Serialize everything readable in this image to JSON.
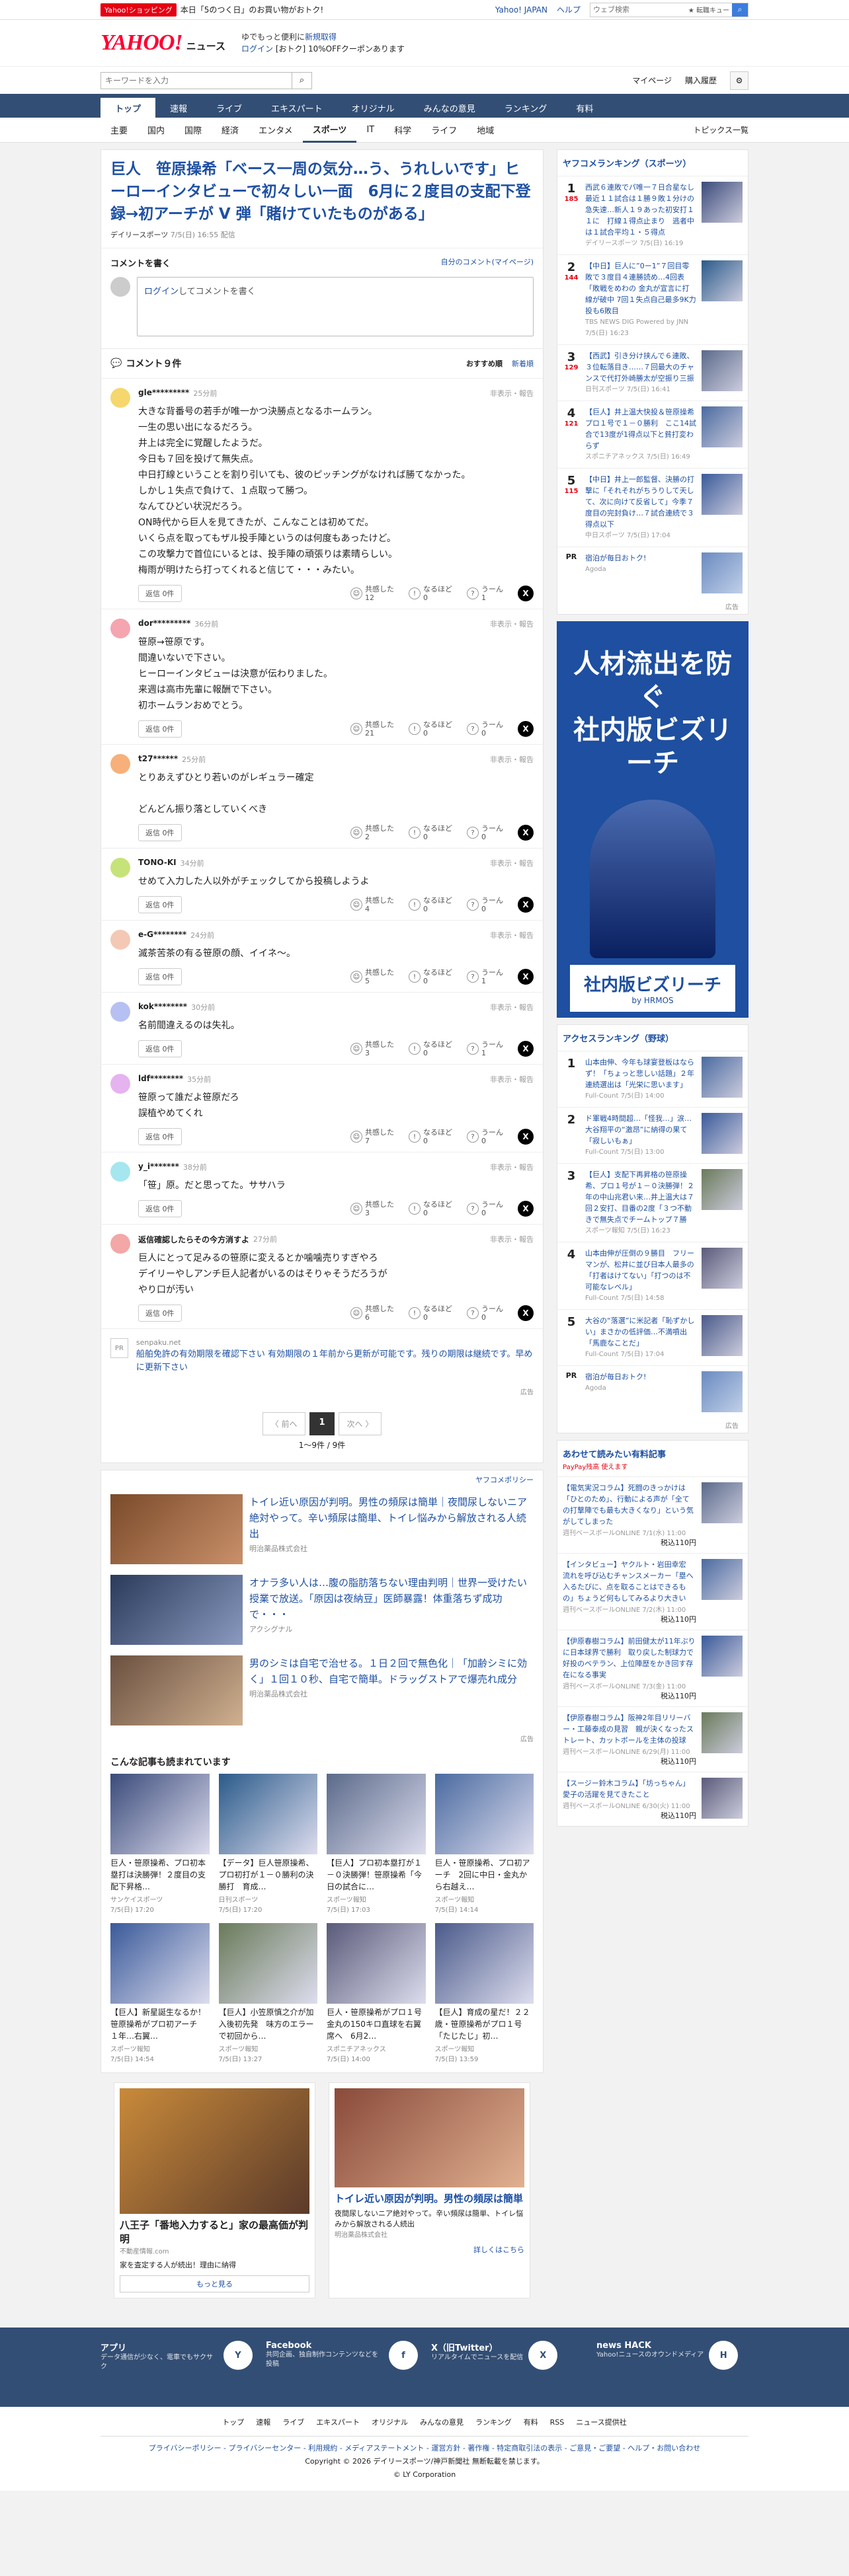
{
  "topbar": {
    "badge": "Yahoo!ショッピング",
    "promo": "本日「5のつく日」のお買い物がおトク!",
    "links": [
      "Yahoo! JAPAN",
      "ヘルプ"
    ],
    "search_placeholder": "ウェブ検索",
    "search_btn": "Q",
    "fav": "★ 転職キュー"
  },
  "header": {
    "logo": "YAHOO!",
    "logo_sub": "JAPAN",
    "news": "ニュース",
    "promo1": "ゆでもっと便利に",
    "promo1b": "新規取得",
    "login": "ログイン",
    "promo2": "[おトク] 10%OFFクーポンあります"
  },
  "search": {
    "placeholder": "キーワードを入力",
    "links": [
      "マイページ",
      "購入履歴"
    ]
  },
  "nav1": [
    "トップ",
    "速報",
    "ライブ",
    "エキスパート",
    "オリジナル",
    "みんなの意見",
    "ランキング",
    "有料"
  ],
  "nav2": [
    "主要",
    "国内",
    "国際",
    "経済",
    "エンタメ",
    "スポーツ",
    "IT",
    "科学",
    "ライフ",
    "地域"
  ],
  "nav2_right": "トピックス一覧",
  "article": {
    "title": "巨人　笹原操希「ベース一周の気分…う、うれしいです」ヒーローインタビューで初々しい一面　6月に２度目の支配下登録→初アーチが V 弾「賭けていたものがある」",
    "source": "デイリースポーツ",
    "date": "7/5(日) 16:55 配信"
  },
  "comment_form": {
    "heading": "コメントを書く",
    "mine": "自分のコメント(マイページ)",
    "login": "ログイン",
    "placeholder": "してコメントを書く"
  },
  "comments_header": {
    "title": "コメント９件",
    "sort1": "おすすめ順",
    "sort2": "新着順"
  },
  "labels": {
    "reply": "返信 0件 ",
    "hide": "非表示・報告",
    "r1": "共感した",
    "r2": "なるほど",
    "r3": "うーん"
  },
  "comments": [
    {
      "name": "gle*********",
      "time": "25分前",
      "text": "大きな背番号の若手が唯一かつ決勝点となるホームラン。\n一生の思い出になるだろう。\n井上は完全に覚醒したようだ。\n今日も７回を投げて無失点。\n中日打線ということを割り引いても、彼のピッチングがなければ勝てなかった。\nしかし１失点で負けて、１点取って勝つ。\nなんてひどい状況だろう。\nON時代から巨人を見てきたが、こんなことは初めてだ。\nいくら点を取ってもザル投手陣というのは何度もあったけど。\nこの攻撃力で首位にいるとは、投手陣の頑張りは素晴らしい。\n梅雨が明けたら打ってくれると信じて・・・みたい。",
      "c1": "12",
      "c2": "0",
      "c3": "1",
      "color": "#f5d76e"
    },
    {
      "name": "dor*********",
      "time": "36分前",
      "text": "笹原→笹原です。\n間違いないで下さい。\nヒーローインタビューは決意が伝わりました。\n来週は高市先輩に報酬で下さい。\n初ホームランおめでとう。",
      "c1": "21",
      "c2": "0",
      "c3": "0",
      "color": "#f5a5b0"
    },
    {
      "name": "t27******",
      "time": "25分前",
      "text": "とりあえずひとり若いのがレギュラー確定\n\nどんどん振り落としていくべき",
      "c1": "2",
      "c2": "0",
      "c3": "0",
      "color": "#f7b07a"
    },
    {
      "name": "TONO-KI",
      "time": "34分前",
      "text": "せめて入力した人以外がチェックしてから投稿しようよ",
      "c1": "4",
      "c2": "0",
      "c3": "0",
      "color": "#c6e37a"
    },
    {
      "name": "e-G********",
      "time": "24分前",
      "text": "滅茶苦茶の有る笹原の顔、イイネ〜。",
      "c1": "5",
      "c2": "0",
      "c3": "1",
      "color": "#f3c9b5"
    },
    {
      "name": "kok********",
      "time": "30分前",
      "text": "名前間違えるのは失礼。",
      "c1": "3",
      "c2": "0",
      "c3": "1",
      "color": "#b7c0f2"
    },
    {
      "name": "ldf********",
      "time": "35分前",
      "text": "笹原って誰だよ笹原だろ\n誤植やめてくれ",
      "c1": "7",
      "c2": "0",
      "c3": "0",
      "color": "#e5b3ef"
    },
    {
      "name": "y_i*******",
      "time": "38分前",
      "text": "「笹」原。だと思ってた。ササハラ",
      "c1": "3",
      "c2": "0",
      "c3": "0",
      "color": "#a6e6ef"
    },
    {
      "name": "返信確認したらその今方消すよ",
      "time": "27分前",
      "text": "巨人にとって足みるの笹原に変えるとか噛噛売りすぎやろ\nデイリーやしアンチ巨人記者がいるのはそりゃそうだろうが\nやり口が汚い",
      "c1": "6",
      "c2": "0",
      "c3": "0",
      "color": "#f3a7a7"
    }
  ],
  "pr_row": {
    "badge": "PR",
    "src": "senpaku.net",
    "text": "船舶免許の有効期限を確認下さい 有効期限の１年前から更新が可能です。残りの期限は継続です。早めに更新下さい"
  },
  "pager": {
    "prev": "〈 前へ",
    "page": "1",
    "next": "次へ 〉",
    "info": "1〜9件 / 9件"
  },
  "yahoo_policy": "ヤフコメポリシー",
  "ad_label": "広告",
  "ads": [
    {
      "title": "トイレ近い原因が判明。男性の頻尿は簡単｜夜間尿しないニア絶対やって。辛い頻尿は簡単、トイレ悩みから解放される人続出",
      "sponsor": "明治薬品株式会社"
    },
    {
      "title": "オナラ多い人は…腹の脂肪落ちない理由判明｜世界一受けたい授業で放送。「原因は夜納豆」医師暴露！体重落ちず成功で・・・",
      "sponsor": "アクシグナル"
    },
    {
      "title": "男のシミは自宅で治せる。１日２回で無色化｜「加齢シミに効く」１回１０秒、自宅で簡単。ドラッグストアで爆売れ成分",
      "sponsor": "明治薬品株式会社"
    }
  ],
  "also_read": {
    "title": "こんな記事も読まれています",
    "items": [
      {
        "t": "巨人・笹原操希、プロ初本塁打は決勝弾！２度目の支配下昇格…",
        "s": "サンケイスポーツ",
        "d": "7/5(日) 17:20"
      },
      {
        "t": "【データ】巨人笹原操希、プロ初打が１－０勝利の決勝打　育成…",
        "s": "日刊スポーツ",
        "d": "7/5(日) 17:20"
      },
      {
        "t": "【巨人】プロ初本塁打が１－０決勝弾！笹原操希「今日の試合に…",
        "s": "スポーツ報知",
        "d": "7/5(日) 17:03"
      },
      {
        "t": "巨人・笹原操希、プロ初アーチ　2回に中日・金丸から右越え…",
        "s": "スポーツ報知",
        "d": "7/5(日) 14:14"
      },
      {
        "t": "【巨人】新星誕生なるか！笹原操希がプロ初アーチ　１年…右翼…",
        "s": "スポーツ報知",
        "d": "7/5(日) 14:54"
      },
      {
        "t": "【巨人】小笠原慎之介が加入後初先発　味方のエラーで初回から…",
        "s": "スポーツ報知",
        "d": "7/5(日) 13:27"
      },
      {
        "t": "巨人・笹原操希がプロ１号　金丸の150キロ直球を右翼席へ　6月2…",
        "s": "スポニチアネックス",
        "d": "7/5(日) 14:00"
      },
      {
        "t": "【巨人】育成の星だ！２２歳・笹原操希がプロ１号「たじたじ」初…",
        "s": "スポーツ報知",
        "d": "7/5(日) 13:59"
      }
    ]
  },
  "bottom_ads": [
    {
      "t": "八王子「番地入力すると」家の最高価が判明",
      "s": "不動産情報.com",
      "d": "家を査定する人が続出！理由に納得",
      "btn": "もっと見る"
    },
    {
      "t": "トイレ近い原因が判明。男性の頻尿は簡単",
      "s": "明治薬品株式会社",
      "d": "夜間尿しないニア絶対やって。辛い頻尿は簡単、トイレ悩みから解放される人続出",
      "btn": "詳しくはこちら"
    }
  ],
  "sidebar": {
    "rank_title": "ヤフコメランキング（スポーツ）",
    "ranks": [
      {
        "n": "1",
        "c": "185",
        "t": "西武６連敗でパ唯一７日合星なし　最近１１試合は１勝９敗１分けの急失速…新人１９あった初安打１１に　打線１得点止まり　逃者中は１試合平均１・５得点",
        "s": "デイリースポーツ 7/5(日) 16:19"
      },
      {
        "n": "2",
        "c": "144",
        "t": "【中日】巨人に”0ー1”７回目零敗で３度目４連勝読め…4回表「敗戦をめわの 金丸が宣言に打線が破中 7回１失点自己最多9K力投も6敗目",
        "s": "TBS NEWS DIG Powered by JNN 7/5(日) 16:23"
      },
      {
        "n": "3",
        "c": "129",
        "t": "【西武】引き分け挟んで６連敗、３位転落目き……７回最大のチャンスで代打外崎勝太が空振り三振",
        "s": "日刊スポーツ 7/5(日) 16:41"
      },
      {
        "n": "4",
        "c": "121",
        "t": "【巨人】井上温大快投＆笹原操希プロ１号で１－０勝利　ここ14試合で13度が1得点以下と貧打変わらず",
        "s": "スポニチアネックス 7/5(日) 16:49"
      },
      {
        "n": "5",
        "c": "115",
        "t": "【中日】井上一郎監督、決勝の打撃に「それそれがちうりして天して、次に向けて反省して」今季７度目の完封負け…７試合連続で３得点以下",
        "s": "中日スポーツ 7/5(日) 17:04"
      }
    ],
    "pr": {
      "t": "宿泊が毎日おトク!",
      "s": "Agoda"
    },
    "bigad": {
      "l1": "人材流出を防ぐ",
      "l2": "社内版ビズリーチ",
      "l3": "社内版ビズリーチ",
      "l4": "by HRMOS"
    },
    "access_title": "アクセスランキング（野球）",
    "access": [
      {
        "n": "1",
        "t": "山本由伸、今年も球宴登板はならず！「ちょっと悲しい話題」２年連続選出は「光栄に思います」",
        "s": "Full-Count 7/5(日) 14:00"
      },
      {
        "n": "2",
        "t": "ド軍戦4時間超…「怪我…」涙…大谷翔平の“激昂”に納得の果て「寂しいもぁ」",
        "s": "Full-Count 7/5(日) 13:00"
      },
      {
        "n": "3",
        "t": "【巨人】支配下再昇格の笹原操希、プロ１号が１－０決勝弾！２年の中山兆君い来…井上温大は７回２安打、目番の2度「３つ不動きで無失点でチームトップ７勝",
        "s": "スポーツ報知 7/5(日) 16:23"
      },
      {
        "n": "4",
        "t": "山本由伸が圧倒の９勝目　フリーマンが、松井に並び日本人最多の「打者はけてない」「打つのは不可能なレベル」",
        "s": "Full-Count 7/5(日) 14:58"
      },
      {
        "n": "5",
        "t": "大谷の“落選”に米記者「恥ずかしい」まさかの低評価…不満噴出「馬鹿なことだ」",
        "s": "Full-Count 7/5(日) 17:04"
      }
    ],
    "pay_title": "あわせて読みたい有料記事",
    "pay_sub": "PayPay残高 使えます",
    "pays": [
      {
        "t": "【電気実況コラム】死闘のきっかけは「ひとのため」、行動による声が「全ての打撃陣でも最も大きくなり」という気がしてしまった",
        "s": "週刊ベースボールONLINE 7/1(水) 11:00",
        "p": "税込110円"
      },
      {
        "t": "【インタビュー】ヤクルト・岩田幸宏　流れを呼び込むチャンスメーカー「塁へ入るたびに、点を取ることはできるもの」ちょうど何もしてみるより大きい",
        "s": "週刊ベースボールONLINE 7/2(木) 11:00",
        "p": "税込110円"
      },
      {
        "t": "【伊原春樹コラム】前田健太が11年ぶりに日本球界で勝利　取り戻した制球力で好投のベテラン、上位陣歴をかき回す存在になる事実",
        "s": "週刊ベースボールONLINE 7/3(金) 11:00",
        "p": "税込110円"
      },
      {
        "t": "【伊原春樹コラム】阪神2年目リリーバー・工藤泰成の見習　親が決くなったストレート、カットボールを主体の投球",
        "s": "週刊ベースボールONLINE 6/29(月) 11:00",
        "p": "税込110円"
      },
      {
        "t": "【スージー鈴木コラム】「坊っちゃん」愛子の活躍を見てきたこと",
        "s": "週刊ベースボールONLINE 6/30(火) 11:00",
        "p": "税込110円"
      }
    ]
  },
  "footer": {
    "blocks": [
      {
        "t": "アプリ",
        "d": "データ通信が少なく、電車でもサクサク",
        "i": "Y"
      },
      {
        "t": "Facebook",
        "d": "共同企画、独自制作コンテンツなどを投稿",
        "i": "f"
      },
      {
        "t": "X（旧Twitter）",
        "d": "リアルタイムでニュースを配信",
        "i": "X"
      },
      {
        "t": "news HACK",
        "d": "Yahoo!ニュースのオウンドメディア",
        "i": "H"
      }
    ],
    "nav": [
      "トップ",
      "速報",
      "ライブ",
      "エキスパート",
      "オリジナル",
      "みんなの意見",
      "ランキング",
      "有料",
      "RSS",
      "ニュース提供社"
    ],
    "links": "プライバシーポリシー - プライバシーセンター - 利用規約 - メディアステートメント - 運営方針 - 著作権 - 特定商取引法の表示 - ご意見・ご要望 - ヘルプ・お問い合わせ",
    "copy": "Copyright © 2026 デイリースポーツ/神戸新聞社 無断転載を禁じます。",
    "corp": "© LY Corporation"
  }
}
